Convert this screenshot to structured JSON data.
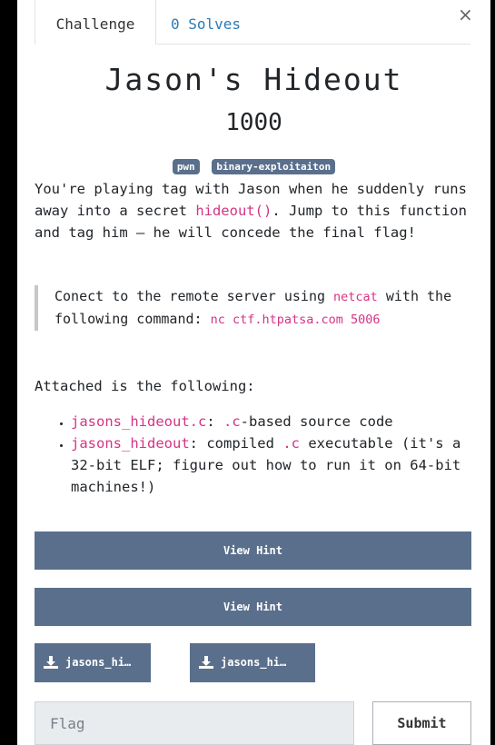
{
  "tabs": {
    "challenge": "Challenge",
    "solves": "0 Solves"
  },
  "close_label": "×",
  "challenge": {
    "name": "Jason's Hideout",
    "value": "1000",
    "tags": [
      "pwn",
      "binary-exploitaiton"
    ]
  },
  "description": {
    "part1": "You're playing tag with Jason when he suddenly runs away into a secret ",
    "code1": "hideout()",
    "part2": ". Jump to this function and tag him — he will concede the final flag!"
  },
  "quote": {
    "part1": "Conect to the remote server using ",
    "code1": "netcat",
    "part2": " with the following command: ",
    "code2": "nc ctf.htpatsa.com 5006"
  },
  "attached_label": "Attached is the following:",
  "files": [
    {
      "code": "jasons_hideout.c",
      "sep": ": ",
      "code2": ".c",
      "text": "-based source code"
    },
    {
      "code": "jasons_hideout",
      "sep": ": compiled ",
      "code2": ".c",
      "text": " executable (it's a 32-bit ELF; figure out how to run it on 64-bit machines!)"
    }
  ],
  "hints": [
    "View Hint",
    "View Hint"
  ],
  "downloads": [
    "jasons_hi…",
    "jasons_hi…"
  ],
  "flag_input": {
    "placeholder": "Flag",
    "value": ""
  },
  "submit_label": "Submit",
  "colors": {
    "primary": "#5a6f8c",
    "code": "#d63384",
    "link": "#2a7ab8"
  }
}
